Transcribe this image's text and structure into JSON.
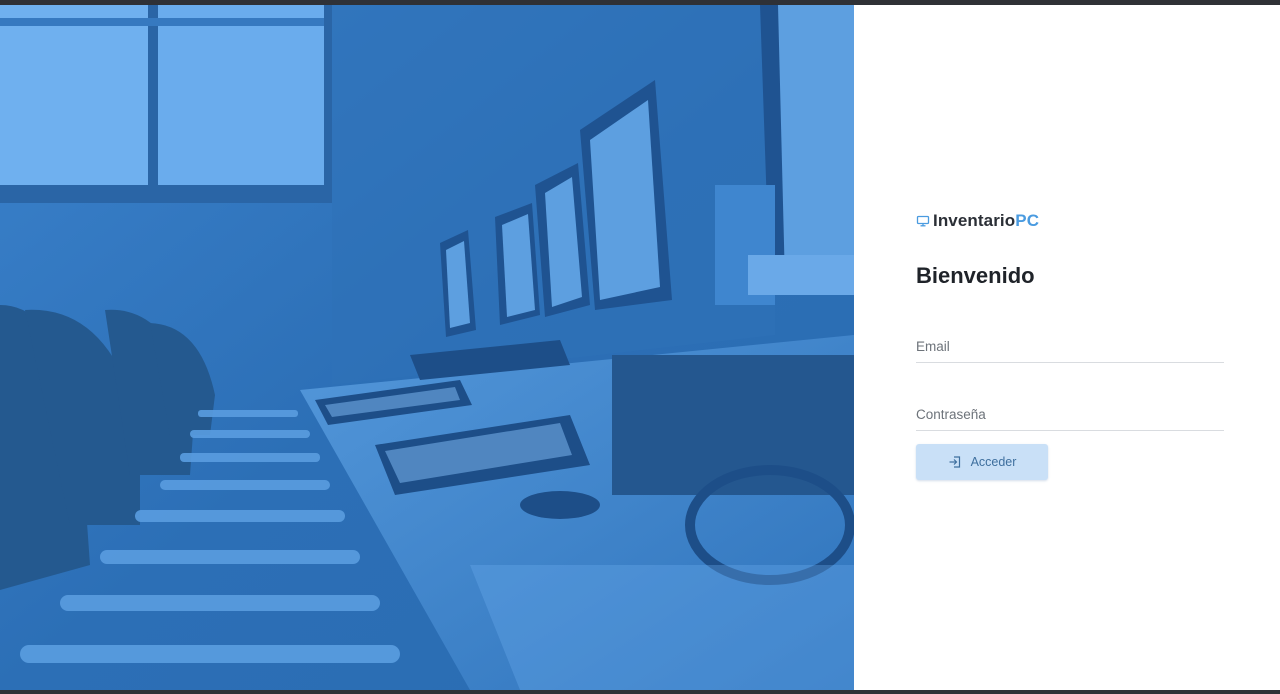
{
  "brand": {
    "name": "Inventario",
    "accent": "PC",
    "icon": "monitor-icon",
    "accent_color": "#4a9be0"
  },
  "login": {
    "title": "Bienvenido",
    "email_label": "Email",
    "password_label": "Contraseña",
    "submit_label": "Acceder",
    "submit_icon": "login-icon"
  },
  "hero": {
    "image": "computer-lab-photo",
    "tint_color": "#2f74bd"
  },
  "colors": {
    "panel_bg": "#ffffff",
    "button_bg": "#c9e0f7",
    "button_text": "#3e6f9e"
  }
}
